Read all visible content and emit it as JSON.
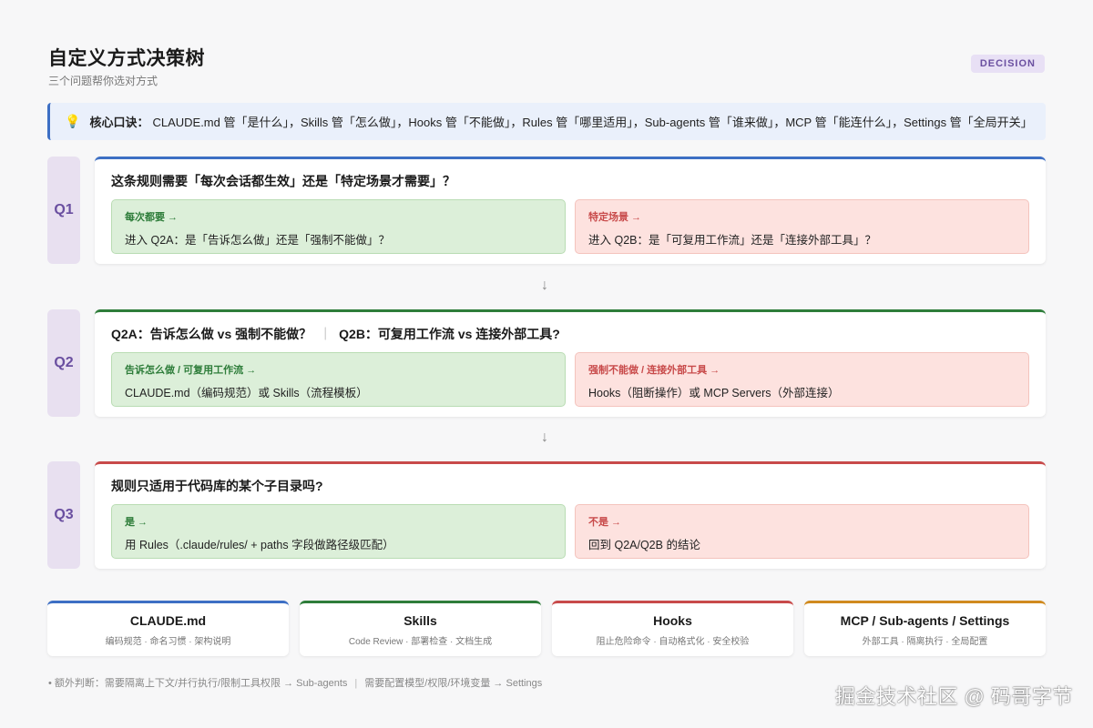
{
  "header": {
    "title": "自定义方式决策树",
    "subtitle": "三个问题帮你选对方式",
    "badge": "DECISION"
  },
  "tip": {
    "icon": "lightbulb-icon",
    "label": "核心口诀：",
    "text": "CLAUDE.md 管「是什么」，Skills 管「怎么做」，Hooks 管「不能做」，Rules 管「哪里适用」，Sub-agents 管「谁来做」，MCP 管「能连什么」，Settings 管「全局开关」"
  },
  "questions": [
    {
      "tag": "Q1",
      "question": "这条规则需要「每次会话都生效」还是「特定场景才需要」？",
      "question_b": "",
      "yes": {
        "label": "每次都要 →",
        "text": "进入 Q2A：是「告诉怎么做」还是「强制不能做」？"
      },
      "no": {
        "label": "特定场景 →",
        "text": "进入 Q2B：是「可复用工作流」还是「连接外部工具」？"
      }
    },
    {
      "tag": "Q2",
      "question": "Q2A：告诉怎么做 vs 强制不能做？",
      "separator": "｜",
      "question_b": "Q2B：可复用工作流 vs 连接外部工具?",
      "yes": {
        "label": "告诉怎么做 / 可复用工作流 →",
        "text": "CLAUDE.md（编码规范）或 Skills（流程模板）"
      },
      "no": {
        "label": "强制不能做 / 连接外部工具 →",
        "text": "Hooks（阻断操作）或 MCP Servers（外部连接）"
      }
    },
    {
      "tag": "Q3",
      "question": "规则只适用于代码库的某个子目录吗?",
      "question_b": "",
      "yes": {
        "label": "是 →",
        "text": "用 Rules（.claude/rules/ + paths 字段做路径级匹配）"
      },
      "no": {
        "label": "不是 →",
        "text": "回到 Q2A/Q2B 的结论"
      }
    }
  ],
  "arrow_glyph": "↓",
  "summary": [
    {
      "title": "CLAUDE.md",
      "desc": "编码规范 · 命名习惯 · 架构说明"
    },
    {
      "title": "Skills",
      "desc": "Code Review · 部署检查 · 文档生成"
    },
    {
      "title": "Hooks",
      "desc": "阻止危险命令 · 自动格式化 · 安全校验"
    },
    {
      "title": "MCP / Sub-agents / Settings",
      "desc": "外部工具 · 隔离执行 · 全局配置"
    }
  ],
  "footnote": {
    "part1": "• 额外判断：需要隔离上下文/并行执行/限制工具权限 → Sub-agents",
    "separator": "|",
    "part2": "需要配置模型/权限/环境变量 → Settings"
  },
  "watermark": "掘金技术社区 @ 码哥字节",
  "colors": {
    "accent_blue": "#3d6fc4",
    "accent_green": "#2e7d3a",
    "accent_red": "#c84a4a",
    "accent_orange": "#d08a1e",
    "tag_purple": "#6a4fa0"
  }
}
